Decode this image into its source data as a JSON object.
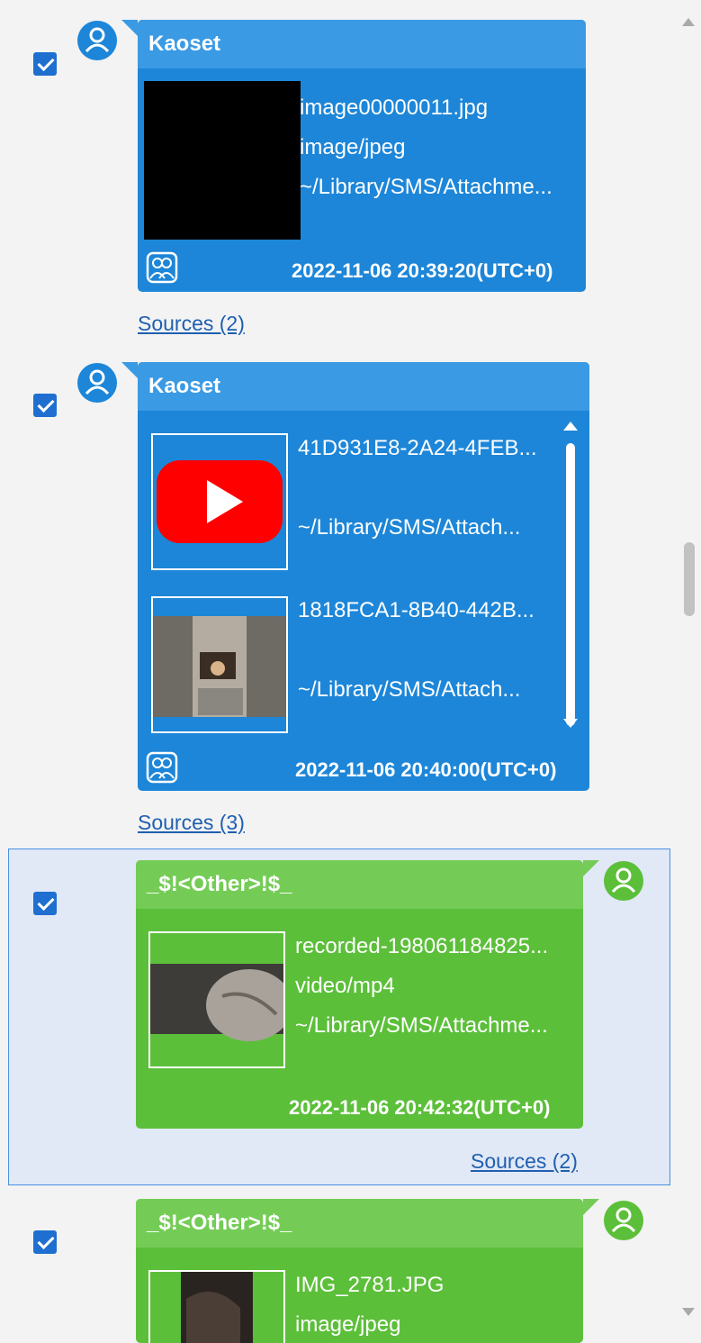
{
  "messages": [
    {
      "sender": "Kaoset",
      "attachments": [
        {
          "filename": "image00000011.jpg",
          "mime": "image/jpeg",
          "path": "~/Library/SMS/Attachme..."
        }
      ],
      "timestamp": "2022-11-06 20:39:20(UTC+0)",
      "sources": "Sources (2)"
    },
    {
      "sender": "Kaoset",
      "attachments": [
        {
          "filename": "41D931E8-2A24-4FEB...",
          "path": "~/Library/SMS/Attach..."
        },
        {
          "filename": "1818FCA1-8B40-442B...",
          "path": "~/Library/SMS/Attach..."
        }
      ],
      "timestamp": "2022-11-06 20:40:00(UTC+0)",
      "sources": "Sources (3)"
    },
    {
      "sender": "_$!<Other>!$_",
      "attachments": [
        {
          "filename": "recorded-198061184825...",
          "mime": "video/mp4",
          "path": "~/Library/SMS/Attachme..."
        }
      ],
      "timestamp": "2022-11-06 20:42:32(UTC+0)",
      "sources": "Sources (2)"
    },
    {
      "sender": "_$!<Other>!$_",
      "attachments": [
        {
          "filename": "IMG_2781.JPG",
          "mime": "image/jpeg"
        }
      ]
    }
  ],
  "colors": {
    "incoming_bubble": "#1d86d8",
    "outgoing_bubble": "#5cbf3a",
    "link": "#1f5fb0",
    "selection_bg": "#e1e8f6"
  },
  "icons": {
    "avatar": "user-avatar-icon",
    "group": "group-icon",
    "youtube": "youtube-play-icon"
  }
}
